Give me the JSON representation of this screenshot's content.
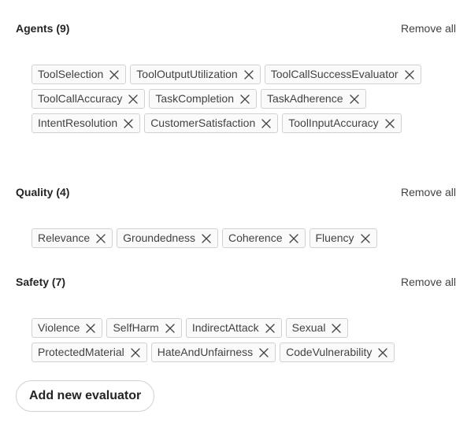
{
  "sections": [
    {
      "title": "Agents (9)",
      "remove_all": "Remove all",
      "tags": [
        "ToolSelection",
        "ToolOutputUtilization",
        "ToolCallSuccessEvaluator",
        "ToolCallAccuracy",
        "TaskCompletion",
        "TaskAdherence",
        "IntentResolution",
        "CustomerSatisfaction",
        "ToolInputAccuracy"
      ]
    },
    {
      "title": "Quality (4)",
      "remove_all": "Remove all",
      "tags": [
        "Relevance",
        "Groundedness",
        "Coherence",
        "Fluency"
      ]
    },
    {
      "title": "Safety (7)",
      "remove_all": "Remove all",
      "tags": [
        "Violence",
        "SelfHarm",
        "IndirectAttack",
        "Sexual",
        "ProtectedMaterial",
        "HateAndUnfairness",
        "CodeVulnerability"
      ]
    }
  ],
  "add_button_label": "Add new evaluator",
  "icons": {
    "tag_remove": "dismiss-icon"
  }
}
